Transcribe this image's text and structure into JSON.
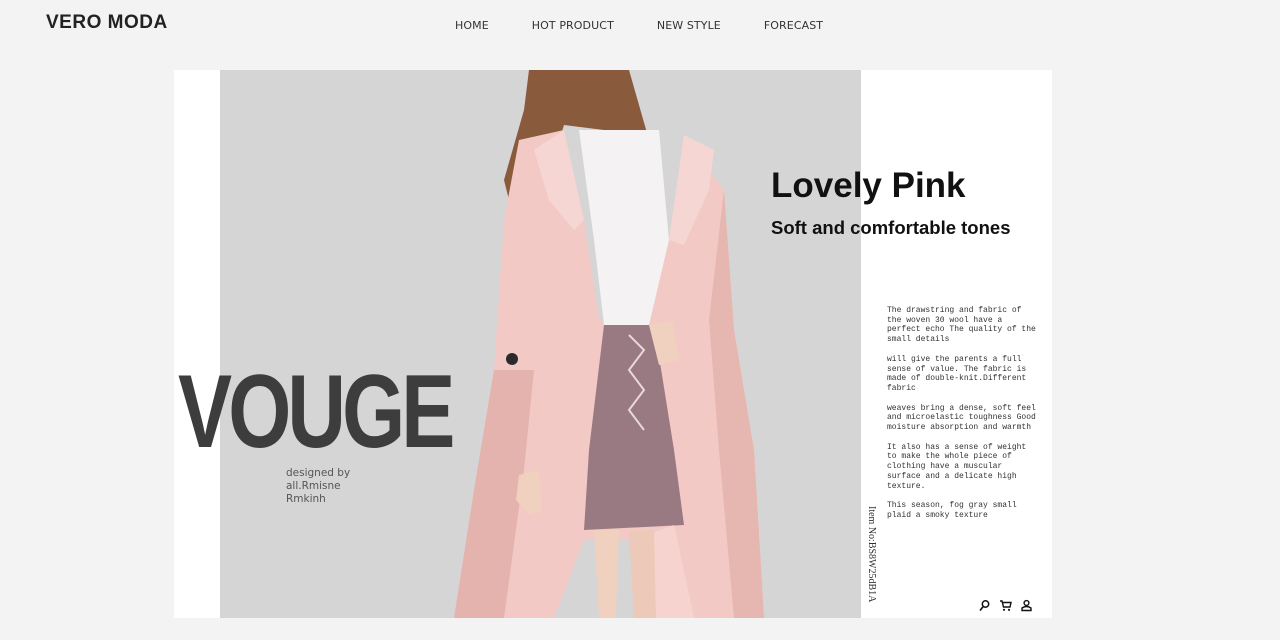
{
  "brand": {
    "logo": "VERO MODA"
  },
  "nav": {
    "items": [
      "HOME",
      "HOT PRODUCT",
      "NEW STYLE",
      "FORECAST"
    ]
  },
  "hero": {
    "big_word": "VOUGE",
    "designer_line1": "designed by all.Rmisne",
    "designer_line2": "Rmkinh",
    "headline": "Lovely Pink",
    "subheadline": "Soft and comfortable tones",
    "description": [
      "The drawstring and fabric of the woven 30 wool have a perfect echo The quality of the small details",
      "will give the parents a full sense of value. The fabric is made of double-knit.Different fabric",
      "weaves bring a dense, soft feel and microelastic toughness Good moisture absorption and warmth",
      "It also has a sense of weight to make the whole piece of clothing have a muscular surface and a delicate high texture.",
      "This season, fog gray small plaid a smoky texture"
    ],
    "item_no": "Item No:BS8W25dB1A"
  },
  "icons": [
    "search-icon",
    "cart-icon",
    "user-icon"
  ],
  "colors": {
    "page_bg": "#f3f3f3",
    "panel_gray": "#d5d5d6",
    "coat_pink": "#f0c7c3",
    "text_dark": "#111111"
  }
}
